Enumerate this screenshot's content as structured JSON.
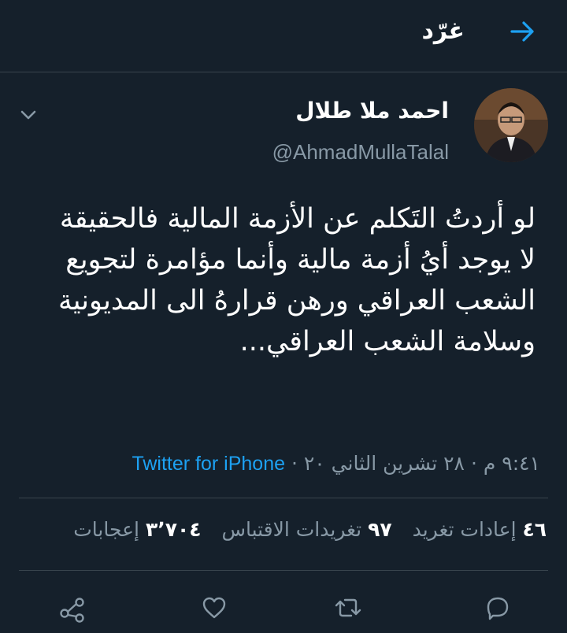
{
  "header": {
    "title": "غرّد",
    "back_icon": "arrow-right-icon"
  },
  "tweet": {
    "author": {
      "display_name": "احمد ملا طلال",
      "handle": "@AhmadMullaTalal"
    },
    "text": "لو أردتُ التَكلم عن الأزمة المالية فالحقيقة\nلا يوجد أيُ أزمة مالية وأنما مؤامرة لتجويع\nالشعب العراقي ورهن قرارهُ الى المديونية\nوسلامة الشعب العراقي...",
    "meta": {
      "time": "٩:٤١ م",
      "separator": "·",
      "date": "٢٨ تشرين الثاني ٢٠",
      "source": "Twitter for iPhone"
    },
    "stats": {
      "retweets_count": "٤٦",
      "retweets_label": "إعادات تغريد",
      "quotes_count": "٩٧",
      "quotes_label": "تغريدات الاقتباس",
      "likes_count": "٣٬٧٠٤",
      "likes_label": "إعجابات"
    }
  },
  "actions": [
    "reply-icon",
    "retweet-icon",
    "like-icon",
    "share-icon"
  ],
  "colors": {
    "background": "#15202b",
    "accent": "#1da1f2",
    "muted": "#8899a6",
    "divider": "#38444d"
  }
}
